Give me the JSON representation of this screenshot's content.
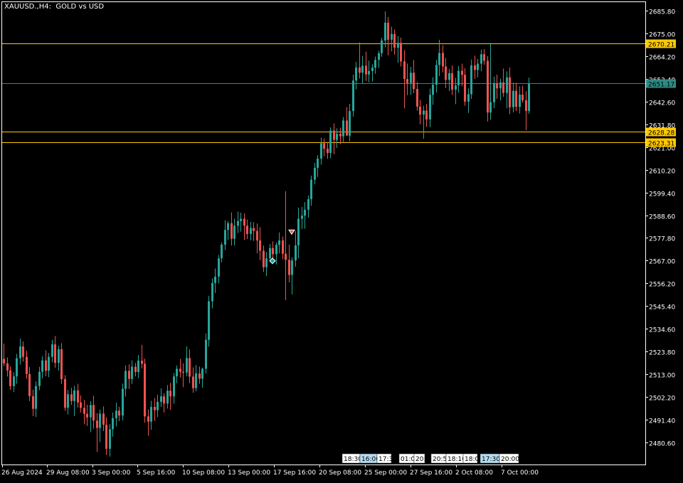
{
  "window": {
    "title": "XAUUSD.,H4:  GOLD vs USD"
  },
  "chart_data": {
    "type": "candlestick",
    "symbol": "XAUUSD.",
    "timeframe": "H4",
    "description": "GOLD vs USD",
    "ylim": [
      2475.6,
      2689.2
    ],
    "y_ticks": [
      "2685.80",
      "2675.00",
      "2664.20",
      "2653.40",
      "2642.60",
      "2631.80",
      "2621.00",
      "2610.20",
      "2599.40",
      "2588.60",
      "2577.80",
      "2567.00",
      "2556.20",
      "2545.40",
      "2534.60",
      "2523.80",
      "2513.00",
      "2502.20",
      "2491.40",
      "2480.60"
    ],
    "x_ticks": [
      "26 Aug 2024",
      "29 Aug 08:00",
      "3 Sep 00:00",
      "5 Sep 16:00",
      "10 Sep 08:00",
      "13 Sep 00:00",
      "17 Sep 16:00",
      "20 Sep 08:00",
      "25 Sep 00:00",
      "27 Sep 16:00",
      "2 Oct 08:00",
      "7 Oct 00:00"
    ],
    "h_lines": [
      {
        "price": "2670.21",
        "color": "#ffc800"
      },
      {
        "price": "2651.17",
        "color": "#2e8b84"
      },
      {
        "price": "2628.28",
        "color": "#ffc800"
      },
      {
        "price": "2623.31",
        "color": "#ffc800"
      }
    ],
    "markers": [
      {
        "type": "sell",
        "price": 2580.6
      },
      {
        "type": "buy",
        "price": 2566.9
      }
    ],
    "event_labels": [
      "18:30",
      "16:00",
      "17:3",
      "01:0",
      "20:",
      "20:5",
      "18:10",
      "18:0",
      "17:30",
      "20:00"
    ],
    "colors": {
      "up": "#26a69a",
      "down": "#ef5350",
      "background": "#000000",
      "axis": "#ffffff"
    },
    "candles": [
      {
        "o": 2520.3,
        "h": 2527.6,
        "l": 2516.9,
        "c": 2518.2
      },
      {
        "o": 2518.2,
        "h": 2521.0,
        "l": 2511.9,
        "c": 2514.8
      },
      {
        "o": 2514.8,
        "h": 2516.7,
        "l": 2505.6,
        "c": 2507.4
      },
      {
        "o": 2507.4,
        "h": 2513.9,
        "l": 2504.5,
        "c": 2512.0
      },
      {
        "o": 2512.0,
        "h": 2522.7,
        "l": 2508.5,
        "c": 2520.6
      },
      {
        "o": 2520.6,
        "h": 2529.9,
        "l": 2517.6,
        "c": 2526.2
      },
      {
        "o": 2526.2,
        "h": 2528.6,
        "l": 2519.0,
        "c": 2521.3
      },
      {
        "o": 2521.3,
        "h": 2524.2,
        "l": 2510.8,
        "c": 2513.1
      },
      {
        "o": 2513.1,
        "h": 2516.4,
        "l": 2500.3,
        "c": 2502.6
      },
      {
        "o": 2502.6,
        "h": 2505.7,
        "l": 2493.1,
        "c": 2496.6
      },
      {
        "o": 2496.6,
        "h": 2509.6,
        "l": 2492.7,
        "c": 2507.4
      },
      {
        "o": 2507.4,
        "h": 2516.5,
        "l": 2505.5,
        "c": 2514.2
      },
      {
        "o": 2514.2,
        "h": 2521.6,
        "l": 2511.0,
        "c": 2519.6
      },
      {
        "o": 2519.6,
        "h": 2524.4,
        "l": 2512.1,
        "c": 2514.7
      },
      {
        "o": 2514.7,
        "h": 2523.1,
        "l": 2511.6,
        "c": 2521.3
      },
      {
        "o": 2521.3,
        "h": 2529.4,
        "l": 2518.7,
        "c": 2527.2
      },
      {
        "o": 2527.2,
        "h": 2531.2,
        "l": 2516.0,
        "c": 2518.4
      },
      {
        "o": 2518.4,
        "h": 2526.6,
        "l": 2514.8,
        "c": 2524.9
      },
      {
        "o": 2524.9,
        "h": 2527.8,
        "l": 2508.4,
        "c": 2510.7
      },
      {
        "o": 2510.7,
        "h": 2512.6,
        "l": 2495.6,
        "c": 2497.1
      },
      {
        "o": 2497.1,
        "h": 2505.6,
        "l": 2493.9,
        "c": 2503.5
      },
      {
        "o": 2503.5,
        "h": 2506.6,
        "l": 2498.5,
        "c": 2500.3
      },
      {
        "o": 2500.3,
        "h": 2507.5,
        "l": 2493.2,
        "c": 2505.3
      },
      {
        "o": 2505.3,
        "h": 2508.5,
        "l": 2497.2,
        "c": 2499.6
      },
      {
        "o": 2499.6,
        "h": 2503.0,
        "l": 2494.9,
        "c": 2497.0
      },
      {
        "o": 2497.0,
        "h": 2500.8,
        "l": 2489.2,
        "c": 2494.2
      },
      {
        "o": 2494.2,
        "h": 2498.5,
        "l": 2488.4,
        "c": 2492.5
      },
      {
        "o": 2492.5,
        "h": 2500.2,
        "l": 2485.5,
        "c": 2498.4
      },
      {
        "o": 2498.4,
        "h": 2502.8,
        "l": 2487.2,
        "c": 2491.0
      },
      {
        "o": 2491.0,
        "h": 2494.5,
        "l": 2476.1,
        "c": 2487.5
      },
      {
        "o": 2487.5,
        "h": 2496.2,
        "l": 2480.8,
        "c": 2494.3
      },
      {
        "o": 2494.3,
        "h": 2497.7,
        "l": 2486.0,
        "c": 2489.0
      },
      {
        "o": 2489.0,
        "h": 2492.6,
        "l": 2474.7,
        "c": 2477.6
      },
      {
        "o": 2477.6,
        "h": 2489.3,
        "l": 2473.9,
        "c": 2486.9
      },
      {
        "o": 2486.9,
        "h": 2494.8,
        "l": 2483.3,
        "c": 2492.1
      },
      {
        "o": 2492.1,
        "h": 2499.5,
        "l": 2488.2,
        "c": 2495.7
      },
      {
        "o": 2495.7,
        "h": 2497.6,
        "l": 2490.7,
        "c": 2493.4
      },
      {
        "o": 2493.4,
        "h": 2508.6,
        "l": 2491.1,
        "c": 2506.1
      },
      {
        "o": 2506.1,
        "h": 2517.2,
        "l": 2502.4,
        "c": 2514.6
      },
      {
        "o": 2514.6,
        "h": 2517.7,
        "l": 2506.0,
        "c": 2510.8
      },
      {
        "o": 2510.8,
        "h": 2519.6,
        "l": 2508.4,
        "c": 2516.6
      },
      {
        "o": 2516.6,
        "h": 2518.4,
        "l": 2512.0,
        "c": 2514.1
      },
      {
        "o": 2514.1,
        "h": 2522.2,
        "l": 2511.1,
        "c": 2519.5
      },
      {
        "o": 2519.5,
        "h": 2527.0,
        "l": 2515.8,
        "c": 2518.0
      },
      {
        "o": 2518.0,
        "h": 2520.4,
        "l": 2490.0,
        "c": 2493.0
      },
      {
        "o": 2493.0,
        "h": 2496.3,
        "l": 2483.8,
        "c": 2490.5
      },
      {
        "o": 2490.5,
        "h": 2500.4,
        "l": 2486.6,
        "c": 2497.5
      },
      {
        "o": 2497.5,
        "h": 2501.7,
        "l": 2490.8,
        "c": 2495.9
      },
      {
        "o": 2495.9,
        "h": 2503.3,
        "l": 2492.7,
        "c": 2499.9
      },
      {
        "o": 2499.9,
        "h": 2506.3,
        "l": 2497.5,
        "c": 2502.5
      },
      {
        "o": 2502.5,
        "h": 2504.0,
        "l": 2494.8,
        "c": 2499.1
      },
      {
        "o": 2499.1,
        "h": 2507.9,
        "l": 2496.7,
        "c": 2505.2
      },
      {
        "o": 2505.2,
        "h": 2508.9,
        "l": 2496.1,
        "c": 2502.5
      },
      {
        "o": 2502.5,
        "h": 2513.6,
        "l": 2499.1,
        "c": 2512.0
      },
      {
        "o": 2512.0,
        "h": 2517.2,
        "l": 2508.8,
        "c": 2515.6
      },
      {
        "o": 2515.6,
        "h": 2520.3,
        "l": 2511.5,
        "c": 2514.2
      },
      {
        "o": 2514.2,
        "h": 2518.2,
        "l": 2506.9,
        "c": 2513.8
      },
      {
        "o": 2513.8,
        "h": 2526.3,
        "l": 2512.0,
        "c": 2520.7
      },
      {
        "o": 2520.7,
        "h": 2524.8,
        "l": 2508.8,
        "c": 2511.9
      },
      {
        "o": 2511.9,
        "h": 2516.3,
        "l": 2504.2,
        "c": 2506.4
      },
      {
        "o": 2506.4,
        "h": 2517.4,
        "l": 2504.9,
        "c": 2513.4
      },
      {
        "o": 2513.4,
        "h": 2516.7,
        "l": 2508.5,
        "c": 2510.9
      },
      {
        "o": 2510.9,
        "h": 2516.2,
        "l": 2506.6,
        "c": 2515.6
      },
      {
        "o": 2515.6,
        "h": 2532.4,
        "l": 2513.4,
        "c": 2529.4
      },
      {
        "o": 2529.4,
        "h": 2550.2,
        "l": 2526.1,
        "c": 2547.7
      },
      {
        "o": 2547.7,
        "h": 2558.5,
        "l": 2544.3,
        "c": 2556.4
      },
      {
        "o": 2556.4,
        "h": 2563.3,
        "l": 2551.6,
        "c": 2559.4
      },
      {
        "o": 2559.4,
        "h": 2569.7,
        "l": 2556.2,
        "c": 2568.1
      },
      {
        "o": 2568.1,
        "h": 2575.7,
        "l": 2566.2,
        "c": 2574.6
      },
      {
        "o": 2574.6,
        "h": 2586.2,
        "l": 2572.0,
        "c": 2581.6
      },
      {
        "o": 2581.6,
        "h": 2585.8,
        "l": 2576.8,
        "c": 2584.8
      },
      {
        "o": 2584.8,
        "h": 2589.9,
        "l": 2574.2,
        "c": 2577.4
      },
      {
        "o": 2577.4,
        "h": 2587.0,
        "l": 2574.2,
        "c": 2583.6
      },
      {
        "o": 2583.6,
        "h": 2590.3,
        "l": 2580.1,
        "c": 2585.8
      },
      {
        "o": 2585.8,
        "h": 2589.8,
        "l": 2580.8,
        "c": 2586.9
      },
      {
        "o": 2586.9,
        "h": 2589.5,
        "l": 2576.9,
        "c": 2583.6
      },
      {
        "o": 2583.6,
        "h": 2586.5,
        "l": 2577.3,
        "c": 2579.7
      },
      {
        "o": 2579.7,
        "h": 2585.5,
        "l": 2576.7,
        "c": 2582.5
      },
      {
        "o": 2582.5,
        "h": 2585.3,
        "l": 2576.4,
        "c": 2581.1
      },
      {
        "o": 2581.1,
        "h": 2584.7,
        "l": 2570.5,
        "c": 2576.6
      },
      {
        "o": 2576.6,
        "h": 2582.9,
        "l": 2567.2,
        "c": 2571.7
      },
      {
        "o": 2571.7,
        "h": 2574.2,
        "l": 2561.6,
        "c": 2563.9
      },
      {
        "o": 2563.9,
        "h": 2571.1,
        "l": 2559.7,
        "c": 2568.1
      },
      {
        "o": 2568.1,
        "h": 2574.9,
        "l": 2567.5,
        "c": 2573.0
      },
      {
        "o": 2573.0,
        "h": 2576.2,
        "l": 2566.8,
        "c": 2570.1
      },
      {
        "o": 2570.1,
        "h": 2575.6,
        "l": 2565.2,
        "c": 2574.5
      },
      {
        "o": 2574.5,
        "h": 2580.4,
        "l": 2570.5,
        "c": 2576.6
      },
      {
        "o": 2576.6,
        "h": 2578.4,
        "l": 2567.7,
        "c": 2570.3
      },
      {
        "o": 2570.3,
        "h": 2600.0,
        "l": 2548.2,
        "c": 2567.4
      },
      {
        "o": 2567.4,
        "h": 2574.6,
        "l": 2556.7,
        "c": 2560.2
      },
      {
        "o": 2560.2,
        "h": 2568.6,
        "l": 2551.0,
        "c": 2567.1
      },
      {
        "o": 2567.1,
        "h": 2581.1,
        "l": 2564.1,
        "c": 2574.3
      },
      {
        "o": 2574.3,
        "h": 2592.2,
        "l": 2568.1,
        "c": 2586.9
      },
      {
        "o": 2586.9,
        "h": 2592.5,
        "l": 2582.0,
        "c": 2588.4
      },
      {
        "o": 2588.4,
        "h": 2594.8,
        "l": 2582.2,
        "c": 2591.2
      },
      {
        "o": 2591.2,
        "h": 2597.9,
        "l": 2587.4,
        "c": 2596.2
      },
      {
        "o": 2596.2,
        "h": 2607.4,
        "l": 2593.1,
        "c": 2605.5
      },
      {
        "o": 2605.5,
        "h": 2613.5,
        "l": 2603.3,
        "c": 2611.1
      },
      {
        "o": 2611.1,
        "h": 2617.1,
        "l": 2606.8,
        "c": 2615.5
      },
      {
        "o": 2615.5,
        "h": 2625.5,
        "l": 2612.6,
        "c": 2622.8
      },
      {
        "o": 2622.8,
        "h": 2625.1,
        "l": 2616.6,
        "c": 2620.2
      },
      {
        "o": 2620.2,
        "h": 2623.4,
        "l": 2615.4,
        "c": 2618.2
      },
      {
        "o": 2618.2,
        "h": 2630.3,
        "l": 2615.7,
        "c": 2628.8
      },
      {
        "o": 2628.8,
        "h": 2632.2,
        "l": 2617.6,
        "c": 2624.4
      },
      {
        "o": 2624.4,
        "h": 2629.9,
        "l": 2620.6,
        "c": 2627.3
      },
      {
        "o": 2627.3,
        "h": 2630.2,
        "l": 2622.3,
        "c": 2626.1
      },
      {
        "o": 2626.1,
        "h": 2635.2,
        "l": 2623.4,
        "c": 2633.6
      },
      {
        "o": 2633.6,
        "h": 2639.9,
        "l": 2627.3,
        "c": 2626.4
      },
      {
        "o": 2626.4,
        "h": 2641.5,
        "l": 2623.7,
        "c": 2638.1
      },
      {
        "o": 2638.1,
        "h": 2655.4,
        "l": 2635.4,
        "c": 2652.6
      },
      {
        "o": 2652.6,
        "h": 2661.4,
        "l": 2648.4,
        "c": 2658.8
      },
      {
        "o": 2658.8,
        "h": 2670.7,
        "l": 2653.6,
        "c": 2656.3
      },
      {
        "o": 2656.3,
        "h": 2664.2,
        "l": 2651.3,
        "c": 2659.6
      },
      {
        "o": 2659.6,
        "h": 2666.3,
        "l": 2652.4,
        "c": 2655.5
      },
      {
        "o": 2655.5,
        "h": 2662.0,
        "l": 2651.8,
        "c": 2657.1
      },
      {
        "o": 2657.1,
        "h": 2660.3,
        "l": 2652.1,
        "c": 2658.7
      },
      {
        "o": 2658.7,
        "h": 2664.0,
        "l": 2655.8,
        "c": 2662.4
      },
      {
        "o": 2662.4,
        "h": 2666.8,
        "l": 2658.6,
        "c": 2665.6
      },
      {
        "o": 2665.6,
        "h": 2672.9,
        "l": 2663.9,
        "c": 2671.6
      },
      {
        "o": 2671.6,
        "h": 2685.5,
        "l": 2668.4,
        "c": 2680.1
      },
      {
        "o": 2680.1,
        "h": 2682.8,
        "l": 2664.6,
        "c": 2672.0
      },
      {
        "o": 2672.0,
        "h": 2678.2,
        "l": 2666.5,
        "c": 2674.7
      },
      {
        "o": 2674.7,
        "h": 2676.9,
        "l": 2664.9,
        "c": 2668.2
      },
      {
        "o": 2668.2,
        "h": 2673.7,
        "l": 2661.0,
        "c": 2670.5
      },
      {
        "o": 2670.5,
        "h": 2673.0,
        "l": 2659.3,
        "c": 2661.7
      },
      {
        "o": 2661.7,
        "h": 2667.1,
        "l": 2639.3,
        "c": 2653.3
      },
      {
        "o": 2653.3,
        "h": 2660.7,
        "l": 2645.7,
        "c": 2651.4
      },
      {
        "o": 2651.4,
        "h": 2659.1,
        "l": 2645.8,
        "c": 2656.3
      },
      {
        "o": 2656.3,
        "h": 2662.4,
        "l": 2646.6,
        "c": 2648.6
      },
      {
        "o": 2648.6,
        "h": 2651.9,
        "l": 2638.2,
        "c": 2640.2
      },
      {
        "o": 2640.2,
        "h": 2643.4,
        "l": 2631.8,
        "c": 2636.4
      },
      {
        "o": 2636.4,
        "h": 2640.6,
        "l": 2624.9,
        "c": 2638.3
      },
      {
        "o": 2638.3,
        "h": 2641.5,
        "l": 2630.6,
        "c": 2634.1
      },
      {
        "o": 2634.1,
        "h": 2648.8,
        "l": 2630.4,
        "c": 2645.8
      },
      {
        "o": 2645.8,
        "h": 2654.2,
        "l": 2641.1,
        "c": 2650.6
      },
      {
        "o": 2650.6,
        "h": 2662.4,
        "l": 2646.9,
        "c": 2660.0
      },
      {
        "o": 2660.0,
        "h": 2672.0,
        "l": 2654.7,
        "c": 2665.7
      },
      {
        "o": 2665.7,
        "h": 2669.4,
        "l": 2656.5,
        "c": 2659.3
      },
      {
        "o": 2659.3,
        "h": 2663.3,
        "l": 2649.0,
        "c": 2652.9
      },
      {
        "o": 2652.9,
        "h": 2658.1,
        "l": 2647.6,
        "c": 2656.1
      },
      {
        "o": 2656.1,
        "h": 2659.7,
        "l": 2645.7,
        "c": 2648.3
      },
      {
        "o": 2648.3,
        "h": 2653.9,
        "l": 2641.4,
        "c": 2650.3
      },
      {
        "o": 2650.3,
        "h": 2659.5,
        "l": 2646.9,
        "c": 2657.2
      },
      {
        "o": 2657.2,
        "h": 2660.6,
        "l": 2649.8,
        "c": 2655.3
      },
      {
        "o": 2655.3,
        "h": 2658.5,
        "l": 2640.6,
        "c": 2642.6
      },
      {
        "o": 2642.6,
        "h": 2648.9,
        "l": 2637.2,
        "c": 2646.1
      },
      {
        "o": 2646.1,
        "h": 2662.6,
        "l": 2643.9,
        "c": 2659.8
      },
      {
        "o": 2659.8,
        "h": 2664.4,
        "l": 2653.3,
        "c": 2657.6
      },
      {
        "o": 2657.6,
        "h": 2662.8,
        "l": 2654.1,
        "c": 2660.6
      },
      {
        "o": 2660.6,
        "h": 2667.3,
        "l": 2657.0,
        "c": 2665.1
      },
      {
        "o": 2665.1,
        "h": 2667.6,
        "l": 2660.1,
        "c": 2662.0
      },
      {
        "o": 2662.0,
        "h": 2664.2,
        "l": 2633.1,
        "c": 2637.4
      },
      {
        "o": 2637.4,
        "h": 2669.9,
        "l": 2634.0,
        "c": 2642.3
      },
      {
        "o": 2642.3,
        "h": 2654.5,
        "l": 2639.4,
        "c": 2651.4
      },
      {
        "o": 2651.4,
        "h": 2655.4,
        "l": 2643.9,
        "c": 2648.9
      },
      {
        "o": 2648.9,
        "h": 2653.5,
        "l": 2643.1,
        "c": 2651.7
      },
      {
        "o": 2651.7,
        "h": 2658.3,
        "l": 2644.8,
        "c": 2646.7
      },
      {
        "o": 2646.7,
        "h": 2657.0,
        "l": 2639.5,
        "c": 2654.1
      },
      {
        "o": 2654.1,
        "h": 2658.8,
        "l": 2636.6,
        "c": 2639.9
      },
      {
        "o": 2639.9,
        "h": 2651.6,
        "l": 2637.5,
        "c": 2647.7
      },
      {
        "o": 2647.7,
        "h": 2651.5,
        "l": 2638.1,
        "c": 2640.1
      },
      {
        "o": 2640.1,
        "h": 2649.9,
        "l": 2636.9,
        "c": 2645.9
      },
      {
        "o": 2645.9,
        "h": 2650.1,
        "l": 2642.1,
        "c": 2643.2
      },
      {
        "o": 2643.2,
        "h": 2647.5,
        "l": 2629.0,
        "c": 2638.1
      },
      {
        "o": 2638.1,
        "h": 2654.0,
        "l": 2636.8,
        "c": 2651.2
      }
    ]
  }
}
